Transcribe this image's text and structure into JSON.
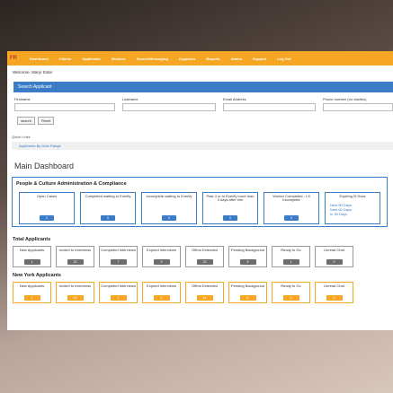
{
  "nav": {
    "logo": "FR",
    "items": [
      "Dashboard",
      "Clients",
      "Applicants",
      "Workers",
      "Search/Messaging",
      "Organizer",
      "Reports",
      "Admin",
      "Support",
      "Log Out"
    ]
  },
  "welcome": "Welcome, Maryr Ester",
  "search": {
    "title": "Search Applicant",
    "fields": [
      {
        "label": "Firstname",
        "value": ""
      },
      {
        "label": "Lastname",
        "value": ""
      },
      {
        "label": "Email Address",
        "value": ""
      },
      {
        "label": "Phone number (no dashes)",
        "value": ""
      }
    ],
    "search_label": "search",
    "reset_label": "Reset"
  },
  "quicklinks": {
    "title": "Quick Links",
    "link": "Applicants By Date Range"
  },
  "main_title": "Main Dashboard",
  "pca": {
    "title": "People & Culture Administration & Compliance",
    "cards": [
      {
        "label": "Open Cases",
        "badge": "2"
      },
      {
        "label": "Completed waiting to Everify",
        "badge": "0"
      },
      {
        "label": "Incomplete waiting to Everify",
        "badge": "0"
      },
      {
        "label": "Past 3 or to Everify more than 3 days after hire",
        "badge": "0"
      },
      {
        "label": "Worker Completed - I-9 Incomplete",
        "badge": "0"
      },
      {
        "label": "Expiring I9 Docs",
        "links": [
          "Next 90 Days",
          "Next 60 Days",
          "In 30 Days"
        ]
      }
    ]
  },
  "total": {
    "title": "Total Applicants",
    "tiles": [
      {
        "label": "New Applicants",
        "badge": "1"
      },
      {
        "label": "Invited to Interviews",
        "badge": "33"
      },
      {
        "label": "Completed Interviews",
        "badge": "7"
      },
      {
        "label": "Expired Interviews",
        "badge": "3"
      },
      {
        "label": "Offers Extended",
        "badge": "23"
      },
      {
        "label": "Pending Background",
        "badge": "5"
      },
      {
        "label": "Ready to Go",
        "badge": "1"
      },
      {
        "label": "Unread Chat",
        "badge": "0"
      }
    ]
  },
  "newyork": {
    "title": "New York Applicants",
    "tiles": [
      {
        "label": "New Applicants",
        "badge": "1"
      },
      {
        "label": "Invited to Interviews",
        "badge": "15"
      },
      {
        "label": "Completed Interviews",
        "badge": "1"
      },
      {
        "label": "Expired Interviews",
        "badge": "2"
      },
      {
        "label": "Offers Extended",
        "badge": "14"
      },
      {
        "label": "Pending Background",
        "badge": "5"
      },
      {
        "label": "Ready to Go",
        "badge": "0"
      },
      {
        "label": "Unread Chat",
        "badge": "0"
      }
    ]
  },
  "colors": {
    "nav": "#f5a623",
    "accent": "#3a7cc6",
    "badge_gray": "#6b6b6b",
    "badge_orange": "#f5a623"
  }
}
